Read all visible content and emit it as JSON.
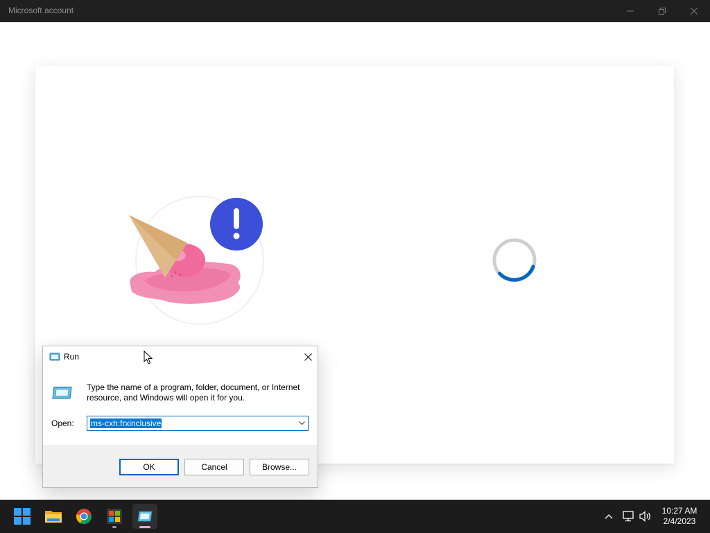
{
  "window": {
    "title": "Microsoft account",
    "controls": {
      "minimize": "minimize-icon",
      "restore": "restore-icon",
      "close": "close-icon"
    }
  },
  "content": {
    "illustration": "melted-ice-cream-with-alert-icon",
    "loading": true
  },
  "run_dialog": {
    "title": "Run",
    "description": "Type the name of a program, folder, document, or Internet resource, and Windows will open it for you.",
    "open_label": "Open:",
    "open_value": "ms-cxh:frxinclusive",
    "buttons": {
      "ok": "OK",
      "cancel": "Cancel",
      "browse": "Browse..."
    }
  },
  "taskbar": {
    "apps": [
      {
        "name": "start",
        "icon": "windows-start-icon"
      },
      {
        "name": "file-explorer",
        "icon": "folder-icon"
      },
      {
        "name": "chrome",
        "icon": "chrome-icon"
      },
      {
        "name": "microsoft-store",
        "icon": "store-icon"
      },
      {
        "name": "run",
        "icon": "run-icon",
        "active": true
      }
    ],
    "tray": {
      "chevron": "chevron-up-icon",
      "network": "network-icon",
      "volume": "volume-icon"
    },
    "clock": {
      "time": "10:27 AM",
      "date": "2/4/2023"
    }
  },
  "colors": {
    "titlebar": "#202020",
    "taskbar": "#1c1c1c",
    "accent": "#0067c0",
    "spinner": "#0067c0",
    "alert_badge": "#3b4fd8"
  }
}
